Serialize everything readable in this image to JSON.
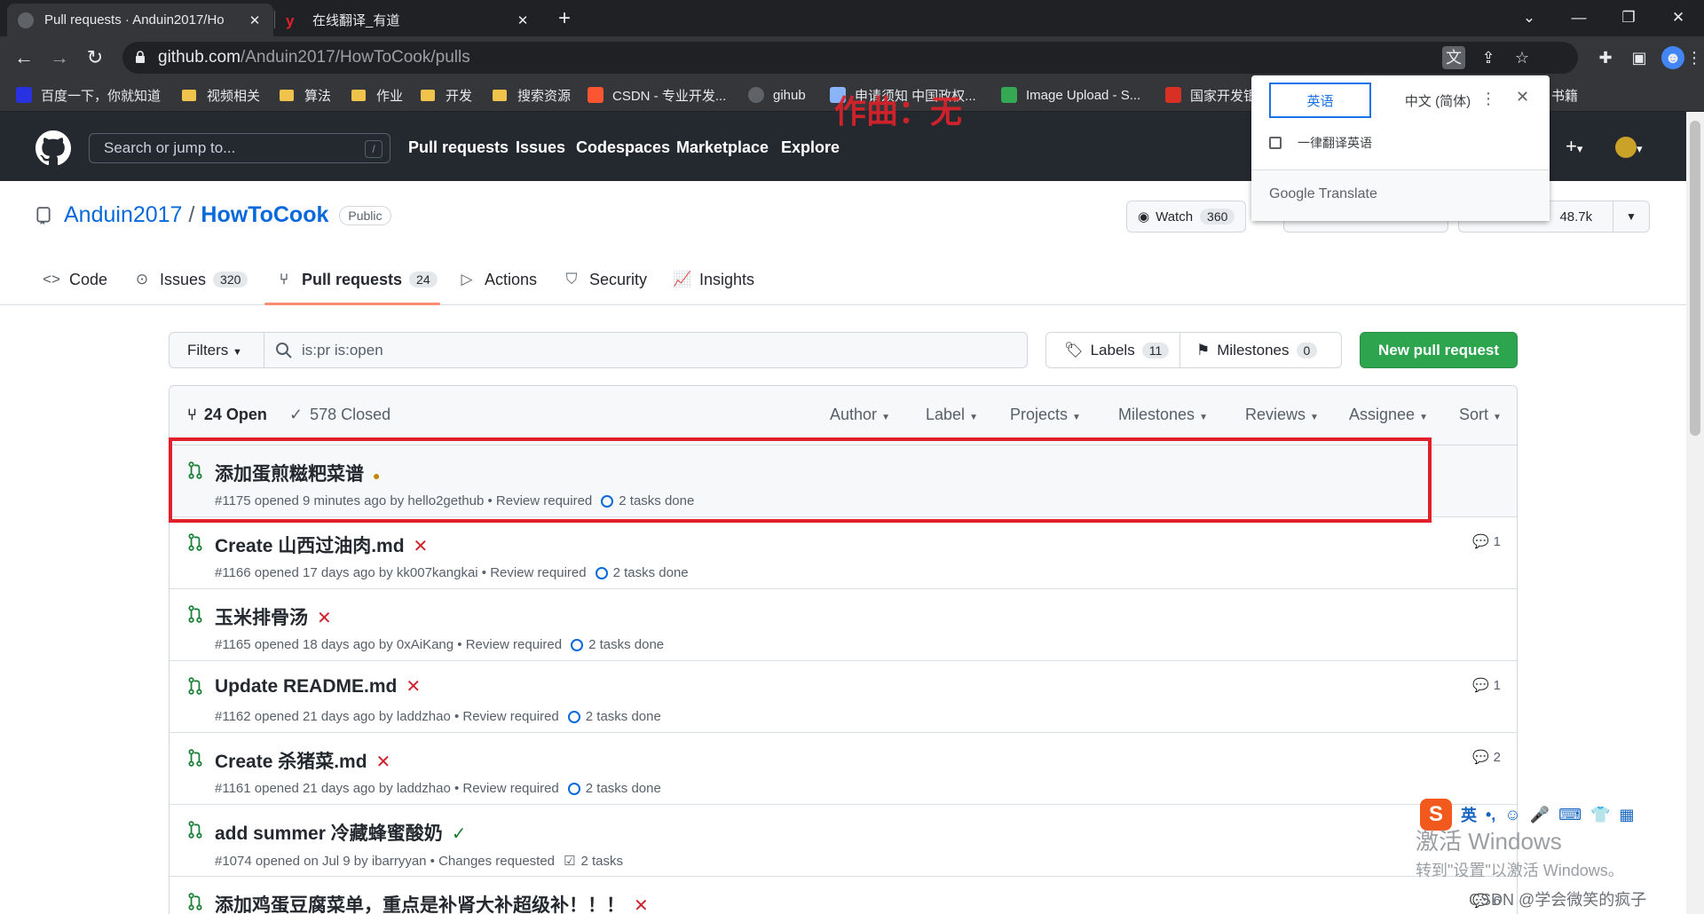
{
  "browser": {
    "tabs": [
      {
        "title": "Pull requests · Anduin2017/Ho",
        "active": true
      },
      {
        "title": "在线翻译_有道",
        "active": false
      }
    ],
    "url_host": "github.com",
    "url_path": "/Anduin2017/HowToCook/pulls",
    "bookmarks": [
      "百度一下，你就知道",
      "视频相关",
      "算法",
      "作业",
      "开发",
      "搜索资源",
      "CSDN - 专业开发...",
      "gihub",
      "申请须知 中国政权...",
      "Image Upload - S...",
      "国家开发银",
      "书籍"
    ]
  },
  "github": {
    "search_placeholder": "Search or jump to...",
    "search_shortcut": "/",
    "nav": [
      "Pull requests",
      "Issues",
      "Codespaces",
      "Marketplace",
      "Explore"
    ],
    "plus": "+",
    "caret": "▾"
  },
  "repo": {
    "owner": "Anduin2017",
    "separator": "/",
    "name": "HowToCook",
    "visibility": "Public",
    "watch_label": "Watch",
    "watch_count": "360",
    "star_count": "48.7k",
    "tabs": [
      {
        "label": "Code",
        "count": ""
      },
      {
        "label": "Issues",
        "count": "320"
      },
      {
        "label": "Pull requests",
        "count": "24"
      },
      {
        "label": "Actions",
        "count": ""
      },
      {
        "label": "Security",
        "count": ""
      },
      {
        "label": "Insights",
        "count": ""
      }
    ]
  },
  "filterbar": {
    "filters_label": "Filters",
    "search_value": "is:pr is:open",
    "labels_label": "Labels",
    "labels_count": "11",
    "milestones_label": "Milestones",
    "milestones_count": "0",
    "new_pr_label": "New pull request"
  },
  "list": {
    "open_label": "24 Open",
    "closed_label": "578 Closed",
    "filters": [
      "Author",
      "Label",
      "Projects",
      "Milestones",
      "Reviews",
      "Assignee",
      "Sort"
    ],
    "rows": [
      {
        "title": "添加蛋煎糍粑菜谱",
        "status": "pending",
        "meta": "#1175 opened 9 minutes ago by hello2gethub • Review required",
        "tasks": "2 tasks done",
        "comments": ""
      },
      {
        "title": "Create 山西过油肉.md",
        "status": "failure",
        "meta": "#1166 opened 17 days ago by kk007kangkai • Review required",
        "tasks": "2 tasks done",
        "comments": "1"
      },
      {
        "title": "玉米排骨汤",
        "status": "failure",
        "meta": "#1165 opened 18 days ago by 0xAiKang • Review required",
        "tasks": "2 tasks done",
        "comments": ""
      },
      {
        "title": "Update README.md",
        "status": "failure",
        "meta": "#1162 opened 21 days ago by laddzhao • Review required",
        "tasks": "2 tasks done",
        "comments": "1"
      },
      {
        "title": "Create 杀猪菜.md",
        "status": "failure",
        "meta": "#1161 opened 21 days ago by laddzhao • Review required",
        "tasks": "2 tasks done",
        "comments": "2"
      },
      {
        "title": "add summer 冷藏蜂蜜酸奶",
        "status": "success",
        "meta": "#1074 opened on Jul 9 by ibarryyan • Changes requested",
        "tasks": "2 tasks",
        "comments": ""
      },
      {
        "title": "添加鸡蛋豆腐菜单，重点是补肾大补超级补！！！",
        "status": "failure",
        "meta": "",
        "tasks": "",
        "comments": "6"
      }
    ]
  },
  "translate_popup": {
    "source_lang": "英语",
    "target_lang": "中文 (简体)",
    "always_translate": "一律翻译英语",
    "footer": "Google Translate"
  },
  "overlays": {
    "video_caption": "作曲：无",
    "windows_activate_1": "激活 Windows",
    "windows_activate_2": "转到\"设置\"以激活 Windows。",
    "csdn_watermark": "CSDN @学会微笑的疯子",
    "ime_label": "英"
  }
}
